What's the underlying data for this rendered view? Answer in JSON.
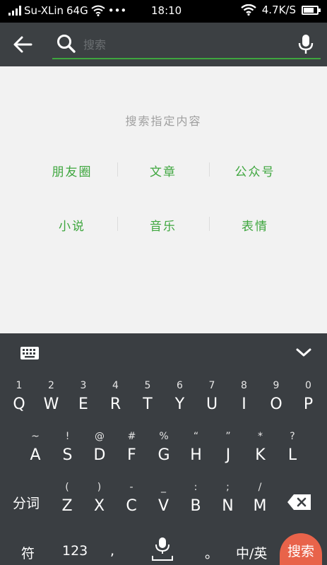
{
  "status_bar": {
    "carrier": "Su-XLin",
    "network": "64G",
    "dots": "•••",
    "time": "18:10",
    "speed": "4.7K/S",
    "battery_level": 0.8
  },
  "search": {
    "placeholder": "搜索",
    "accent_color": "#3ea63e"
  },
  "content": {
    "hint": "搜索指定内容",
    "options_row1": [
      "朋友圈",
      "文章",
      "公众号"
    ],
    "options_row2": [
      "小说",
      "音乐",
      "表情"
    ]
  },
  "keyboard": {
    "row1": [
      {
        "sub": "1",
        "main": "Q"
      },
      {
        "sub": "2",
        "main": "W"
      },
      {
        "sub": "3",
        "main": "E"
      },
      {
        "sub": "4",
        "main": "R"
      },
      {
        "sub": "5",
        "main": "T"
      },
      {
        "sub": "6",
        "main": "Y"
      },
      {
        "sub": "7",
        "main": "U"
      },
      {
        "sub": "8",
        "main": "I"
      },
      {
        "sub": "9",
        "main": "O"
      },
      {
        "sub": "0",
        "main": "P"
      }
    ],
    "row2": [
      {
        "sub": "~",
        "main": "A"
      },
      {
        "sub": "!",
        "main": "S"
      },
      {
        "sub": "@",
        "main": "D"
      },
      {
        "sub": "#",
        "main": "F"
      },
      {
        "sub": "%",
        "main": "G"
      },
      {
        "sub": "“",
        "main": "H"
      },
      {
        "sub": "”",
        "main": "J"
      },
      {
        "sub": "*",
        "main": "K"
      },
      {
        "sub": "?",
        "main": "L"
      }
    ],
    "row3_label": "分词",
    "row3": [
      {
        "sub": "(",
        "main": "Z"
      },
      {
        "sub": ")",
        "main": "X"
      },
      {
        "sub": "-",
        "main": "C"
      },
      {
        "sub": "_",
        "main": "V"
      },
      {
        "sub": ":",
        "main": "B"
      },
      {
        "sub": ";",
        "main": "N"
      },
      {
        "sub": "/",
        "main": "M"
      }
    ],
    "symbols_label": "符",
    "numbers_label": "123",
    "comma_label": ",",
    "period_label": "。",
    "lang_label": "中/英",
    "search_label": "搜索",
    "search_color": "#e8634a"
  }
}
